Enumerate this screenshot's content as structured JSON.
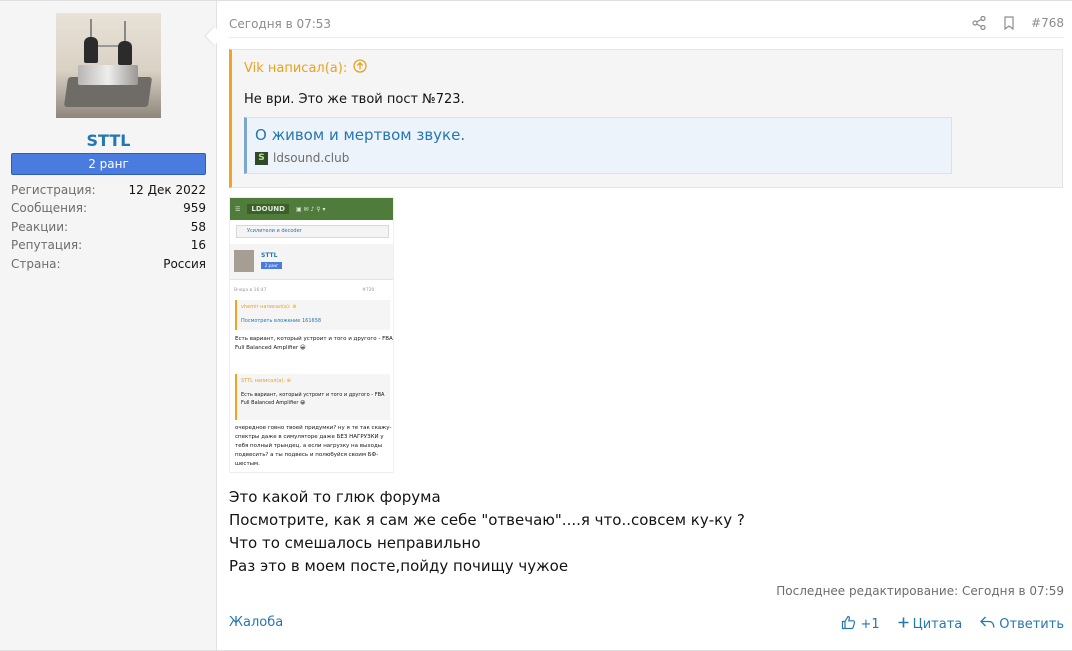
{
  "user": {
    "name": "STTL",
    "rank": "2 ранг",
    "stats": [
      {
        "label": "Регистрация:",
        "value": "12 Дек 2022"
      },
      {
        "label": "Сообщения:",
        "value": "959"
      },
      {
        "label": "Реакции:",
        "value": "58"
      },
      {
        "label": "Репутация:",
        "value": "16"
      },
      {
        "label": "Страна:",
        "value": "Россия"
      }
    ]
  },
  "post": {
    "date": "Сегодня в 07:53",
    "number": "#768",
    "quote": {
      "author": "Vik написал(а):",
      "text": "Не ври. Это же твой пост №723.",
      "link_title": "О живом и мертвом звуке.",
      "link_domain": "ldsound.club",
      "favicon_letter": "S"
    },
    "screenshot": {
      "logo": "LD",
      "logo_suffix": "OUND",
      "breadcrumb": "Усилители и decoder",
      "user_name": "STTL",
      "user_rank": "2 ранг",
      "date": "Вчера в 16:47",
      "post_no": "#720",
      "quote1_head": "vhemir написал(а): ⊕",
      "quote1_body": "Посмотреть вложение 161658",
      "text1": "Есть вариант, который устроит и того и другого - FBA",
      "text1b": "Full Balanced Amplifier 😀",
      "quote2_head": "STTL написал(а): ⊕",
      "quote2_body": "Есть вариант, который устроит и того и другого - FBA",
      "quote2_body2": "Full Balanced Amplifier 😀",
      "text2": "очередное говно твоей придумки? ну я те так скажу- спектры даже в симуляторе даже БЕЗ НАГРУЗКИ у тебя полный трындец. а если нагрузку на выходы подвесить? а ты подвесь и полюбуйся своим БФ- шестым."
    },
    "body_lines": [
      "Это какой то глюк форума",
      "Посмотрите, как я сам же себе \"отвечаю\"....я что..совсем ку-ку ?",
      "Что то смешалось неправильно",
      "Раз это в моем посте,пойду почищу чужое"
    ],
    "edited": "Последнее редактирование: Сегодня в 07:59",
    "report": "Жалоба",
    "like_count": "+1",
    "quote_action": "Цитата",
    "reply_action": "Ответить"
  },
  "icons": {
    "share": "share-icon",
    "bookmark": "bookmark-icon",
    "arrow_up": "arrow-up-circle-icon",
    "like": "thumbs-up-icon",
    "plus": "plus-icon",
    "reply": "reply-icon"
  },
  "colors": {
    "link": "#2577b1",
    "quote_accent": "#f0a422",
    "rank_bg": "#4a7bdf",
    "muted": "#8c8c8c"
  }
}
